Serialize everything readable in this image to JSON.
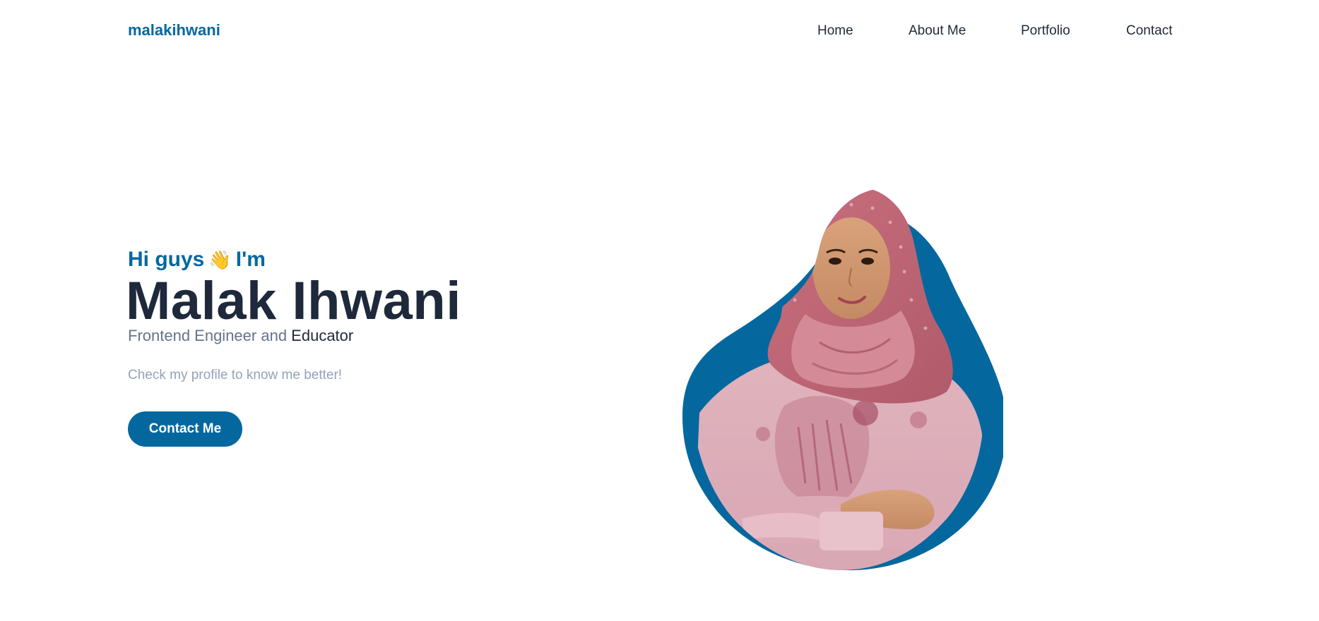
{
  "header": {
    "logo": "malakihwani",
    "nav": [
      {
        "label": "Home"
      },
      {
        "label": "About Me"
      },
      {
        "label": "Portfolio"
      },
      {
        "label": "Contact"
      }
    ]
  },
  "hero": {
    "greeting_prefix": "Hi guys",
    "wave_emoji": "👋",
    "greeting_suffix": "I'm",
    "name": "Malak Ihwani",
    "role_prefix": "Frontend Engineer and ",
    "role_highlight": "Educator",
    "tagline": "Check my profile to know me better!",
    "cta_label": "Contact Me"
  },
  "portrait": {
    "description_icon": "profile-photo",
    "blob_color": "#04689f"
  },
  "colors": {
    "accent": "#04689f",
    "heading": "#1e293b",
    "muted": "#64748b",
    "light": "#94a3b8",
    "nav_text": "#1f2937"
  }
}
